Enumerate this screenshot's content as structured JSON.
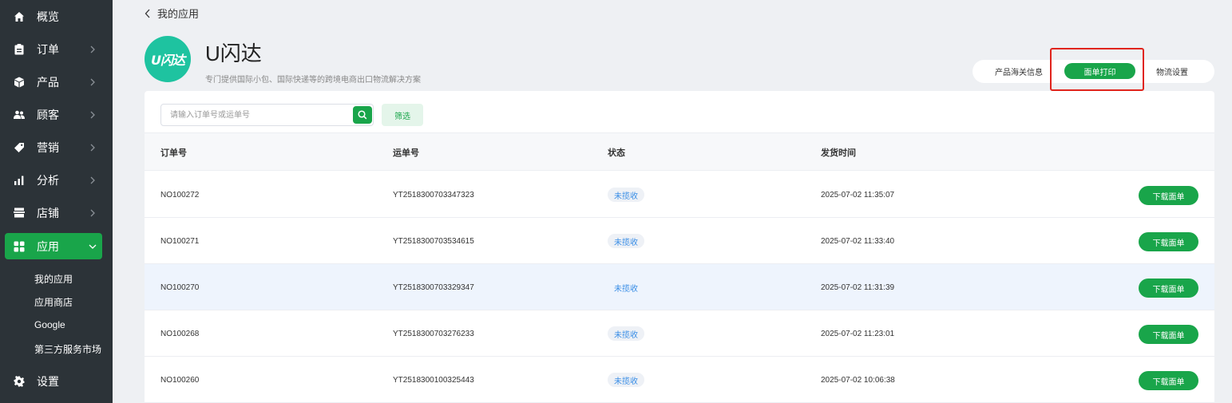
{
  "sidebar": {
    "items": [
      {
        "label": "概览",
        "icon": "home-icon"
      },
      {
        "label": "订单",
        "icon": "clipboard-icon"
      },
      {
        "label": "产品",
        "icon": "box-icon"
      },
      {
        "label": "顾客",
        "icon": "users-icon"
      },
      {
        "label": "营销",
        "icon": "tag-icon"
      },
      {
        "label": "分析",
        "icon": "bar-chart-icon"
      },
      {
        "label": "店铺",
        "icon": "store-icon"
      },
      {
        "label": "应用",
        "icon": "apps-icon",
        "active": true
      },
      {
        "label": "设置",
        "icon": "gear-icon"
      }
    ],
    "sub_items": [
      "我的应用",
      "应用商店",
      "Google",
      "第三方服务市场"
    ]
  },
  "header": {
    "back_label": "我的应用",
    "logo_text": "U闪达",
    "app_title": "U闪达",
    "app_subtitle": "专门提供国际小包、国际快递等的跨境电商出口物流解决方案"
  },
  "tabs": [
    "产品海关信息",
    "面单打印",
    "物流设置"
  ],
  "active_tab": "面单打印",
  "search": {
    "placeholder": "请输入订单号或运单号",
    "value": ""
  },
  "filter_label": "筛选",
  "table": {
    "columns": [
      "订单号",
      "运单号",
      "状态",
      "发货时间"
    ],
    "rows": [
      {
        "order": "NO100272",
        "waybill": "YT2518300703347323",
        "status": "未揽收",
        "time": "2025-07-02 11:35:07",
        "action": "下载面单"
      },
      {
        "order": "NO100271",
        "waybill": "YT2518300703534615",
        "status": "未揽收",
        "time": "2025-07-02 11:33:40",
        "action": "下载面单"
      },
      {
        "order": "NO100270",
        "waybill": "YT2518300703329347",
        "status": "未揽收",
        "time": "2025-07-02 11:31:39",
        "action": "下载面单"
      },
      {
        "order": "NO100268",
        "waybill": "YT2518300703276233",
        "status": "未揽收",
        "time": "2025-07-02 11:23:01",
        "action": "下载面单"
      },
      {
        "order": "NO100260",
        "waybill": "YT2518300100325443",
        "status": "未揽收",
        "time": "2025-07-02 10:06:38",
        "action": "下载面单"
      }
    ]
  },
  "colors": {
    "accent": "#19a54a",
    "sidebar_bg": "#2c3338",
    "status_text": "#3a8ee6",
    "highlight_box": "#e0241c"
  }
}
